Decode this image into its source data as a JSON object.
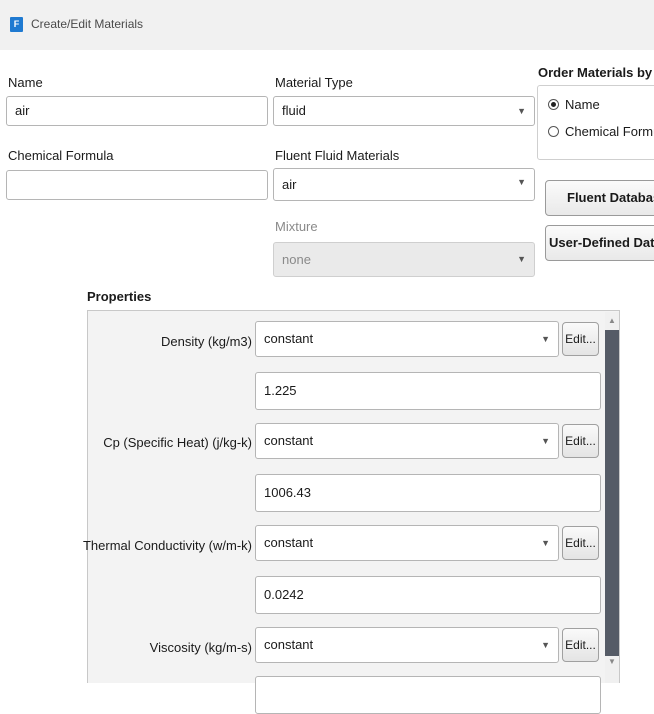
{
  "window": {
    "title": "Create/Edit Materials",
    "icon": "F"
  },
  "name": {
    "label": "Name",
    "value": "air"
  },
  "material_type": {
    "label": "Material Type",
    "value": "fluid"
  },
  "order_by": {
    "label": "Order Materials by",
    "options": [
      {
        "label": "Name",
        "selected": true
      },
      {
        "label": "Chemical Formula",
        "selected": false
      }
    ]
  },
  "chemical_formula": {
    "label": "Chemical Formula",
    "value": ""
  },
  "fluent_fluid_materials": {
    "label": "Fluent Fluid Materials",
    "value": "air"
  },
  "mixture": {
    "label": "Mixture",
    "value": "none",
    "disabled": true
  },
  "buttons": {
    "fluent_database": "Fluent Database...",
    "user_defined_database": "User-Defined Database..."
  },
  "properties": {
    "title": "Properties",
    "rows": [
      {
        "label": "Density (kg/m3)",
        "method": "constant",
        "value": "1.225",
        "edit": "Edit..."
      },
      {
        "label": "Cp (Specific Heat) (j/kg-k)",
        "method": "constant",
        "value": "1006.43",
        "edit": "Edit..."
      },
      {
        "label": "Thermal Conductivity (w/m-k)",
        "method": "constant",
        "value": "0.0242",
        "edit": "Edit..."
      },
      {
        "label": "Viscosity (kg/m-s)",
        "method": "constant",
        "value": "",
        "edit": "Edit..."
      }
    ]
  }
}
